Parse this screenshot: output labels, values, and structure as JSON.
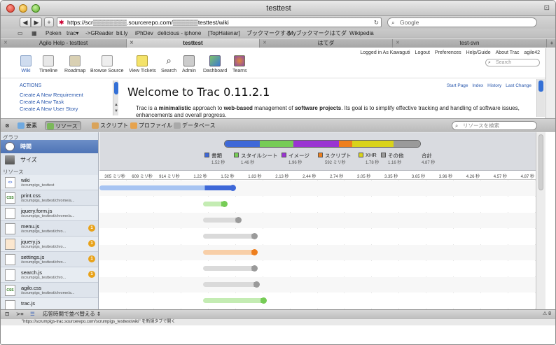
{
  "window": {
    "title": "testtest"
  },
  "url": {
    "value": "https://scr▒▒▒▒▒▒▒▒.sourcerepo.com/▒▒▒▒▒▒testtest/wiki",
    "search_placeholder": "Google"
  },
  "bookmarks": [
    "Poken",
    "trac▾",
    "->GReader",
    "bit.ly",
    "iPhDev",
    "delicious - iphone",
    "[TopHatenar]",
    "ブックマークする",
    "Myブックマーク",
    "はてダ",
    "Wikipedia"
  ],
  "tabs": [
    "Agilo Help - testtest",
    "testtest",
    "はてダ",
    "test-svn"
  ],
  "trac": {
    "metanav": [
      "Logged in As Kawaguti",
      "Logout",
      "Preferences",
      "Help/Guide",
      "About Trac",
      "agile42"
    ],
    "search_placeholder": "Search",
    "mainnav": [
      "Wiki",
      "Timeline",
      "Roadmap",
      "Browse Source",
      "View Tickets",
      "Search",
      "Admin",
      "Dashboard",
      "Teams"
    ],
    "actions_title": "ACTIONS",
    "actions": [
      "Create A New Requirement",
      "Create A New Task",
      "Create A New User Story"
    ],
    "wikinav": [
      "Start Page",
      "Index",
      "History",
      "Last Change"
    ],
    "welcome": "Welcome to Trac 0.11.2.1",
    "intro_1": "Trac is a ",
    "intro_b1": "minimalistic",
    "intro_2": " approach to ",
    "intro_b2": "web-based",
    "intro_3": " management of ",
    "intro_b3": "software projects",
    "intro_4": ". Its goal is to simplify effective tracking and handling of software issues, enhancements and overall progress."
  },
  "inspector": {
    "toolbar": [
      "要素",
      "リソース",
      "スクリプト",
      "プロファイル",
      "データベース"
    ],
    "search_placeholder": "リソースを検索",
    "graph_section": "グラフ",
    "graphs": [
      "時間",
      "サイズ"
    ],
    "resources_section": "リソース",
    "resources": [
      {
        "name": "wiki",
        "path": "/scrumpigs_testtest",
        "type": "doc",
        "warn": ""
      },
      {
        "name": "print.css",
        "path": "/scrumpigs_testtest/chrome/a...",
        "type": "css",
        "warn": ""
      },
      {
        "name": "jquery.form.js",
        "path": "/scrumpigs_testtest/chrome/a...",
        "type": "js",
        "warn": ""
      },
      {
        "name": "menu.js",
        "path": "/scrumpigs_testtest/chro...",
        "type": "js",
        "warn": "1"
      },
      {
        "name": "jquery.js",
        "path": "/scrumpigs_testtest/chro...",
        "type": "js2",
        "warn": "1"
      },
      {
        "name": "settings.js",
        "path": "/scrumpigs_testtest/chro...",
        "type": "js",
        "warn": "1"
      },
      {
        "name": "search.js",
        "path": "/scrumpigs_testtest/chro...",
        "type": "js",
        "warn": "1"
      },
      {
        "name": "agilo.css",
        "path": "/scrumpigs_testtest/chrome/a...",
        "type": "css",
        "warn": ""
      },
      {
        "name": "trac.js",
        "path": "",
        "type": "js",
        "warn": ""
      }
    ],
    "legend": [
      {
        "name": "書類",
        "value": "1.52 秒",
        "color": "#3e68d8"
      },
      {
        "name": "スタイルシート",
        "value": "1.46 秒",
        "color": "#76cc56"
      },
      {
        "name": "イメージ",
        "value": "1.96 秒",
        "color": "#9a34d2"
      },
      {
        "name": "スクリプト",
        "value": "592 ミリ秒",
        "color": "#ee7f1e"
      },
      {
        "name": "XHR",
        "value": "1.78 秒",
        "color": "#d9d31a"
      },
      {
        "name": "その他",
        "value": "1.16 秒",
        "color": "#9a9a9a"
      },
      {
        "name": "合計",
        "value": "4.87 秒",
        "color": ""
      }
    ],
    "ticks": [
      "305 ミリ秒",
      "609 ミリ秒",
      "914 ミリ秒",
      "1.22 秒",
      "1.52 秒",
      "1.83 秒",
      "2.13 秒",
      "2.44 秒",
      "2.74 秒",
      "3.05 秒",
      "3.35 秒",
      "3.65 秒",
      "3.96 秒",
      "4.26 秒",
      "4.57 秒",
      "4.87 秒"
    ],
    "sort_label": "応答時間で並べ替える",
    "warning_count": "8"
  },
  "chart_data": {
    "type": "bar",
    "x_unit": "秒",
    "xlim": [
      0,
      4.87
    ],
    "rows": [
      {
        "name": "wiki",
        "start": 0.0,
        "latency_end": 1.18,
        "end": 1.52,
        "kind": "doc"
      },
      {
        "name": "print.css",
        "start": 1.16,
        "latency_end": 1.36,
        "end": 1.42,
        "kind": "css"
      },
      {
        "name": "jquery.form.js",
        "start": 1.16,
        "latency_end": 1.52,
        "end": 1.58,
        "kind": "js"
      },
      {
        "name": "menu.js",
        "start": 1.16,
        "latency_end": 1.7,
        "end": 1.76,
        "kind": "js"
      },
      {
        "name": "jquery.js",
        "start": 1.16,
        "latency_end": 1.7,
        "end": 1.76,
        "kind": "js2"
      },
      {
        "name": "settings.js",
        "start": 1.16,
        "latency_end": 1.7,
        "end": 1.76,
        "kind": "js"
      },
      {
        "name": "search.js",
        "start": 1.16,
        "latency_end": 1.72,
        "end": 1.78,
        "kind": "js"
      },
      {
        "name": "agilo.css",
        "start": 1.16,
        "latency_end": 1.8,
        "end": 1.86,
        "kind": "css"
      }
    ]
  },
  "status": {
    "text": "\"https://scrumpigs-trac.sourcerepo.com/scrumpigs_testtest/wiki\" を新規タブで開く"
  }
}
